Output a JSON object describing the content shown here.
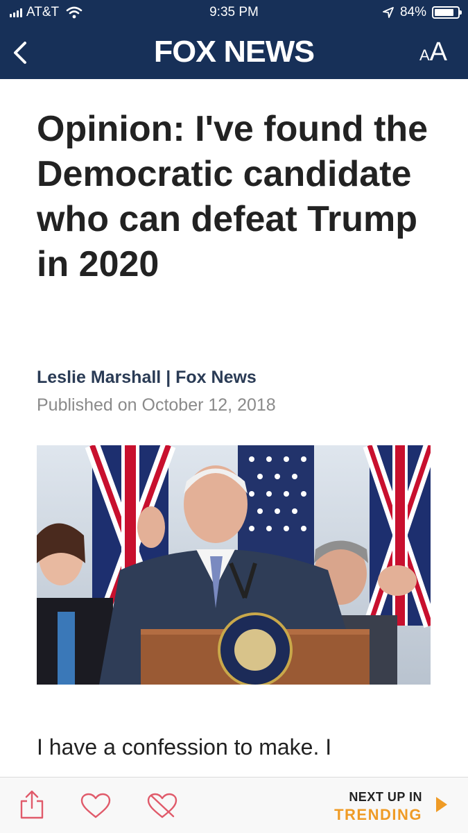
{
  "status_bar": {
    "carrier": "AT&T",
    "time": "9:35 PM",
    "battery": "84%",
    "battery_level": 0.84
  },
  "header": {
    "logo": "FOX NEWS",
    "text_size_small": "A",
    "text_size_large": "A",
    "icons": [
      "back-chevron-icon",
      "text-size-icon"
    ]
  },
  "article": {
    "headline": "Opinion: I've found the Democratic candidate who can defeat Trump in 2020",
    "byline": "Leslie Marshall | Fox News",
    "published": "Published on October 12, 2018",
    "body_first_line": "I have a confession to make. I"
  },
  "bottom_bar": {
    "icons": [
      "share-icon",
      "heart-icon",
      "heart-crossed-icon",
      "play-arrow-icon"
    ],
    "next_up_label": "NEXT UP IN",
    "next_up_section": "TRENDING"
  },
  "colors": {
    "header_bg": "#173058",
    "accent": "#ef9b26",
    "byline": "#2a3b55"
  }
}
